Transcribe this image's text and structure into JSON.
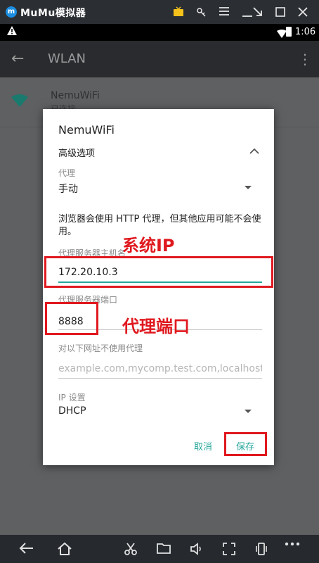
{
  "emulator": {
    "logo_letter": "m",
    "title": "MuMu模拟器"
  },
  "status_bar": {
    "time": "1:06"
  },
  "action_bar": {
    "back_glyph": "←",
    "title": "WLAN",
    "menu_glyph": "⋮"
  },
  "background_list": {
    "ssid": "NemuWiFi",
    "status": "已连接"
  },
  "dialog": {
    "title": "NemuWiFi",
    "advanced_label": "高级选项",
    "proxy_label": "代理",
    "proxy_value": "手动",
    "note": "浏览器会使用 HTTP 代理，但其他应用可能不会使用。",
    "host_label": "代理服务器主机名",
    "host_value": "172.20.10.3",
    "port_label": "代理服务器端口",
    "port_value": "8888",
    "bypass_label": "对以下网址不使用代理",
    "bypass_placeholder": "example.com,mycomp.test.com,localhost",
    "ip_label": "IP 设置",
    "ip_value": "DHCP",
    "cancel_label": "取消",
    "save_label": "保存"
  },
  "annotations": {
    "system_ip": "系统IP",
    "proxy_port": "代理端口"
  },
  "icons": {
    "wifi_color": "#1a9a8a",
    "accent": "#26a69a",
    "annotation_red": "#e0191f"
  }
}
